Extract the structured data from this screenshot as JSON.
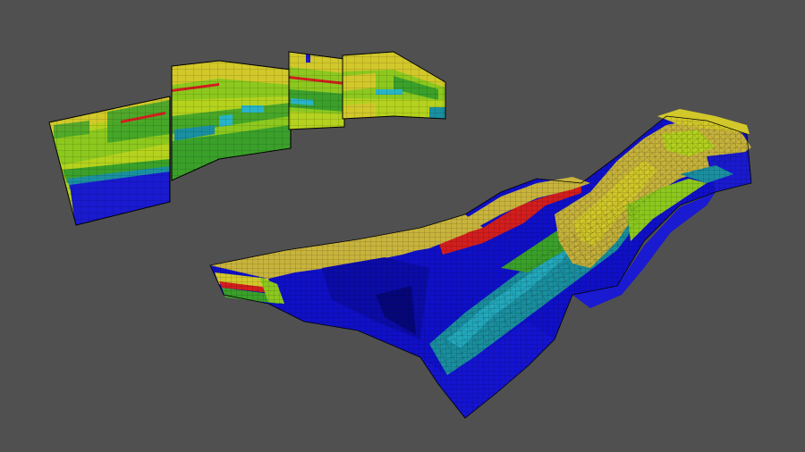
{
  "viewport": {
    "background": "#505050"
  },
  "colors": {
    "deep_blue": "#1010c8",
    "blue": "#1a2fd6",
    "teal": "#1a8fa0",
    "cyan": "#28b4c8",
    "green": "#3aa02a",
    "lime": "#8cc81e",
    "yellow_green": "#b4d21e",
    "yellow": "#d2c82a",
    "khaki": "#c8b43c",
    "red": "#d21e1e",
    "grid": "#000000"
  },
  "fence_panels": [
    {
      "name": "fence-panel-1"
    },
    {
      "name": "fence-panel-2"
    },
    {
      "name": "fence-panel-3"
    },
    {
      "name": "fence-panel-4"
    }
  ],
  "grid_model": {
    "name": "3d-grid-model"
  }
}
